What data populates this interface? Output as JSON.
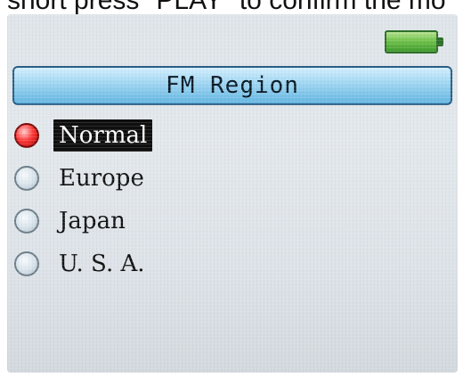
{
  "caption": "short press \"PLAY\" to confirm the mo",
  "screen": {
    "title": "FM Region",
    "options": [
      {
        "label": "Normal",
        "selected": true
      },
      {
        "label": "Europe",
        "selected": false
      },
      {
        "label": "Japan",
        "selected": false
      },
      {
        "label": "U. S. A.",
        "selected": false
      }
    ],
    "selected_option": "Normal",
    "battery_icon": "battery-icon",
    "colors": {
      "title_bar_top": "#d3efff",
      "title_bar_bottom": "#64b6e2",
      "selected_radio": "#ff3b3b",
      "selected_label_bg": "#0f0f0f",
      "battery_green": "#6fc24a"
    }
  }
}
